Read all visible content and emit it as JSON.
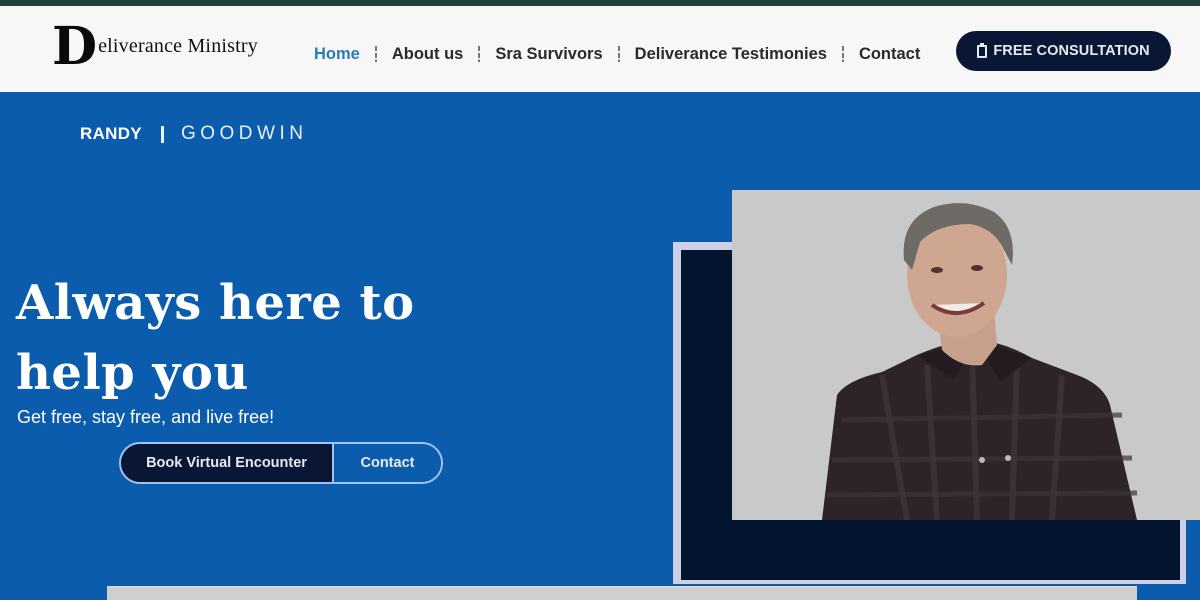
{
  "header": {
    "logo": {
      "initial": "D",
      "rest": "eliverance Ministry"
    },
    "nav": [
      {
        "label": "Home",
        "active": true
      },
      {
        "label": "About us",
        "active": false
      },
      {
        "label": "Sra Survivors",
        "active": false
      },
      {
        "label": "Deliverance Testimonies",
        "active": false
      },
      {
        "label": "Contact",
        "active": false
      }
    ],
    "cta": {
      "label": "FREE CONSULTATION",
      "icon": "clipboard-icon"
    }
  },
  "hero": {
    "brand": {
      "first": "RANDY",
      "last": "GOODWIN"
    },
    "headline": "Always here to help you",
    "subline": "Get free, stay free, and live free!",
    "buttons": {
      "primary": "Book Virtual Encounter",
      "secondary": "Contact"
    },
    "photo_alt": "Smiling man with gray hair wearing a dark plaid shirt"
  },
  "colors": {
    "hero_bg": "#0b5cad",
    "navy": "#0a1734",
    "nav_active": "#2a7ab8",
    "header_bg": "#f7f7f7",
    "top_strip": "#22403a"
  }
}
